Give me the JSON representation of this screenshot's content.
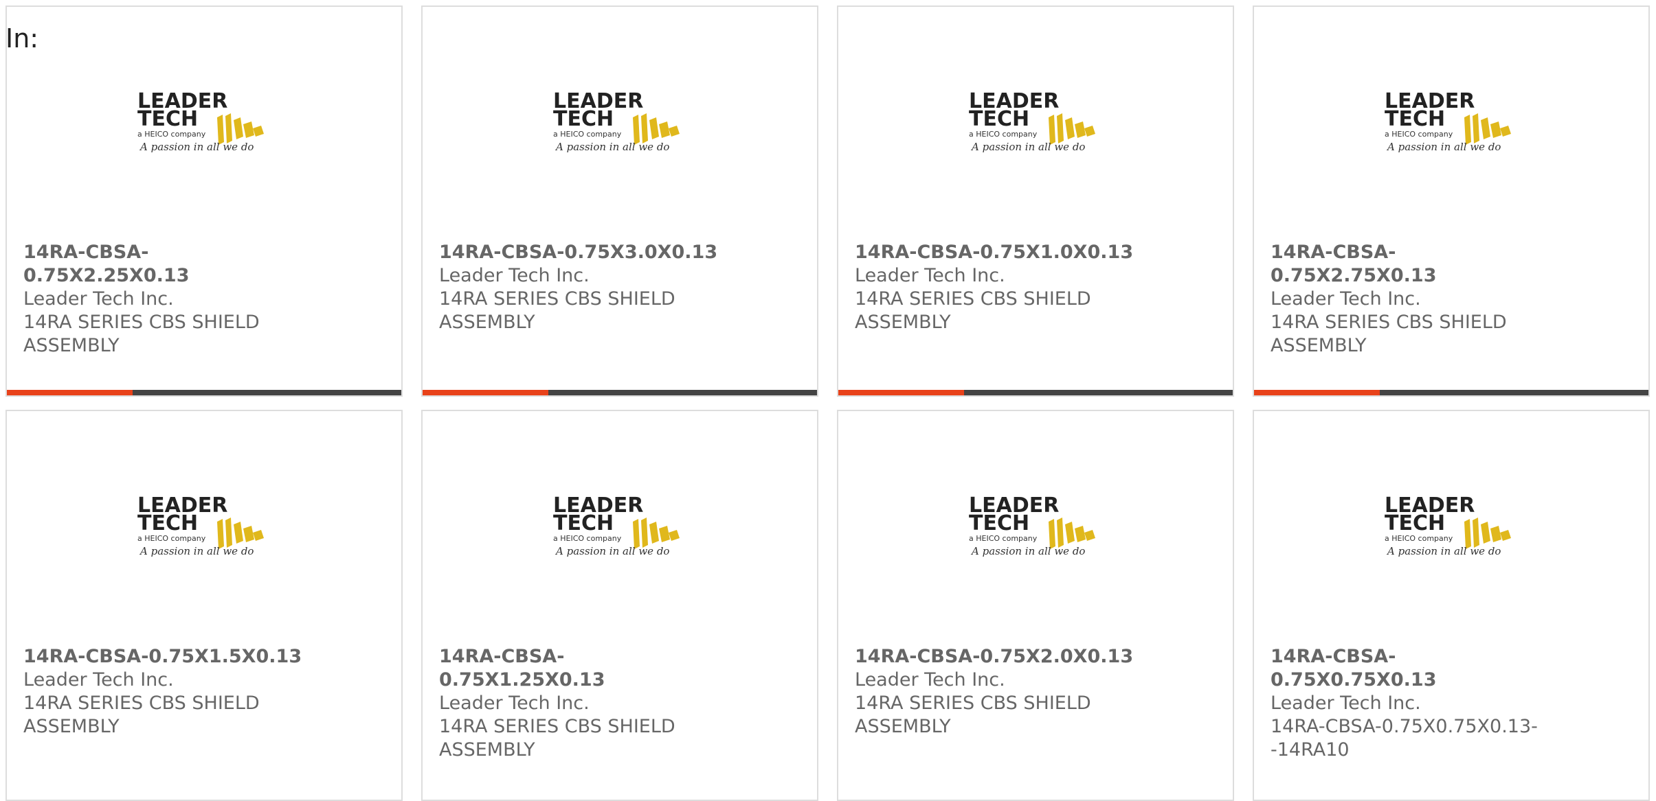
{
  "header": {
    "label": "In:"
  },
  "accent_color": "#e8421a",
  "bar_color": "#444444",
  "logo": {
    "line1": "LEADER",
    "line2": "TECH",
    "company": "a HEICO company",
    "tagline": "A passion in all we do"
  },
  "products": [
    {
      "part": "14RA-CBSA-0.75X2.25X0.13",
      "maker": "Leader Tech Inc.",
      "desc": "14RA SERIES CBS SHIELD ASSEMBLY",
      "bar": true
    },
    {
      "part": "14RA-CBSA-0.75X3.0X0.13",
      "maker": "Leader Tech Inc.",
      "desc": "14RA SERIES CBS SHIELD ASSEMBLY",
      "bar": true
    },
    {
      "part": "14RA-CBSA-0.75X1.0X0.13",
      "maker": "Leader Tech Inc.",
      "desc": "14RA SERIES CBS SHIELD ASSEMBLY",
      "bar": true
    },
    {
      "part": "14RA-CBSA-0.75X2.75X0.13",
      "maker": "Leader Tech Inc.",
      "desc": "14RA SERIES CBS SHIELD ASSEMBLY",
      "bar": true
    },
    {
      "part": "14RA-CBSA-0.75X1.5X0.13",
      "maker": "Leader Tech Inc.",
      "desc": "14RA SERIES CBS SHIELD ASSEMBLY",
      "bar": false
    },
    {
      "part": "14RA-CBSA-0.75X1.25X0.13",
      "maker": "Leader Tech Inc.",
      "desc": "14RA SERIES CBS SHIELD ASSEMBLY",
      "bar": false
    },
    {
      "part": "14RA-CBSA-0.75X2.0X0.13",
      "maker": "Leader Tech Inc.",
      "desc": "14RA SERIES CBS SHIELD ASSEMBLY",
      "bar": false
    },
    {
      "part": "14RA-CBSA-0.75X0.75X0.13",
      "maker": "Leader Tech Inc.",
      "desc": "14RA-CBSA-0.75X0.75X0.13--14RA10",
      "bar": false
    }
  ]
}
